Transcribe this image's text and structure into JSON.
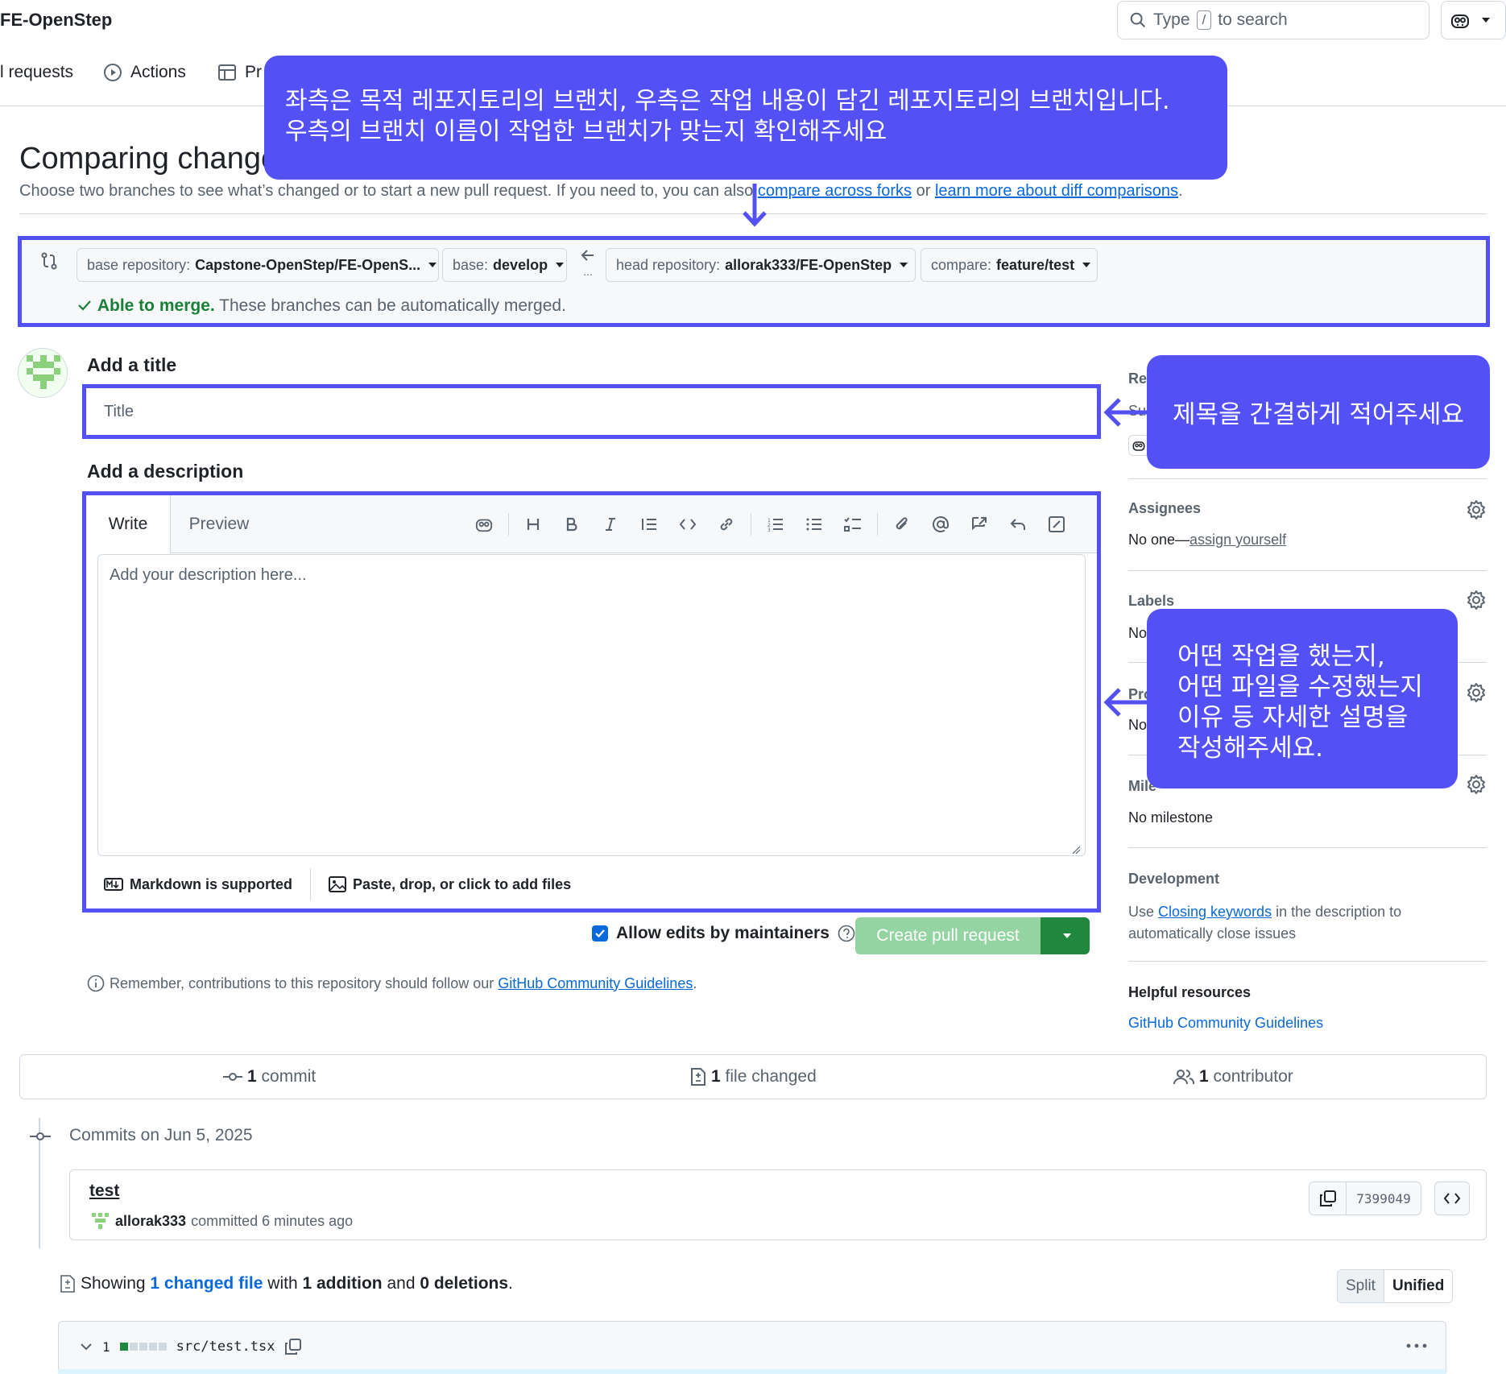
{
  "header": {
    "repo_name": "FE-OpenStep",
    "search_type": "Type",
    "search_key": "/",
    "search_rest": "to search"
  },
  "nav": {
    "pull_requests": "l requests",
    "actions": "Actions",
    "projects": "Pr"
  },
  "page": {
    "title": "Comparing change",
    "subtitle_pre": "Choose two branches to see what’s changed or to start a new pull request. If you need to, you can also ",
    "link_compare_forks": "compare across forks",
    "subtitle_or": " or ",
    "link_learn_more": "learn more about diff comparisons",
    "subtitle_end": "."
  },
  "compare": {
    "base_repo_label": "base repository:",
    "base_repo_value": "Capstone-OpenStep/FE-OpenS...",
    "base_label": "base:",
    "base_value": "develop",
    "head_repo_label": "head repository:",
    "head_repo_value": "allorak333/FE-OpenStep",
    "compare_label": "compare:",
    "compare_value": "feature/test",
    "merge_bold": "Able to merge.",
    "merge_rest": " These branches can be automatically merged.",
    "arrow_dots": "..."
  },
  "form": {
    "title_heading": "Add a title",
    "title_placeholder": "Title",
    "description_heading": "Add a description",
    "tab_write": "Write",
    "tab_preview": "Preview",
    "description_placeholder": "Add your description here...",
    "markdown_note": "Markdown is supported",
    "attach_note": "Paste, drop, or click to add files",
    "allow_edits": "Allow edits by maintainers",
    "create_button": "Create pull request",
    "remember_pre": "Remember, contributions to this repository should follow our ",
    "remember_link": "GitHub Community Guidelines",
    "remember_end": "."
  },
  "sidebar": {
    "reviewers_partial": "Rev",
    "suggestion_partial": "Sug",
    "assignees_heading": "Assignees",
    "assignees_value_pre": "No one—",
    "assignees_link": "assign yourself",
    "labels_heading": "Labels",
    "labels_partial": "No",
    "projects_partial": "Pro",
    "projects_value_partial": "No",
    "milestone_heading_partial": "Mile",
    "milestone_value": "No milestone",
    "development_heading": "Development",
    "development_pre": "Use ",
    "development_link": "Closing keywords",
    "development_post": " in the description to",
    "development_line2": "automatically close issues",
    "helpful_heading": "Helpful resources",
    "helpful_link": "GitHub Community Guidelines"
  },
  "annotations": {
    "top_line1": "좌측은 목적 레포지토리의 브랜치, 우측은 작업 내용이 담긴 레포지토리의 브랜치입니다.",
    "top_line2": "우측의 브랜치 이름이 작업한 브랜치가 맞는지 확인해주세요",
    "title_tip": "제목을 간결하게 적어주세요",
    "desc_line1": "어떤 작업을 했는지,",
    "desc_line2": "어떤 파일을 수정했는지",
    "desc_line3": "이유 등 자세한 설명을",
    "desc_line4": "작성해주세요.",
    "accent_color": "#5351f5"
  },
  "stats": {
    "commits_count": "1",
    "commits_label": " commit",
    "files_count": "1",
    "files_label": " file changed",
    "contributors_count": "1",
    "contributors_label": " contributor"
  },
  "commits": {
    "date_heading": "Commits on Jun 5, 2025",
    "title": "test",
    "author": "allorak333",
    "meta": "committed 6 minutes ago",
    "sha": "7399049"
  },
  "diff": {
    "showing_pre": "Showing ",
    "changed_link": "1 changed file",
    "with": " with ",
    "additions": "1 addition",
    "and": " and ",
    "deletions": "0 deletions",
    "end": ".",
    "split": "Split",
    "unified": "Unified",
    "file_count": "1",
    "file_name": "src/test.tsx"
  },
  "colors": {
    "merge_green": "#1a7f37",
    "link_blue": "#0969da",
    "create_btn_disabled": "#94d3a2",
    "create_btn_dropdown": "#1f883d"
  }
}
